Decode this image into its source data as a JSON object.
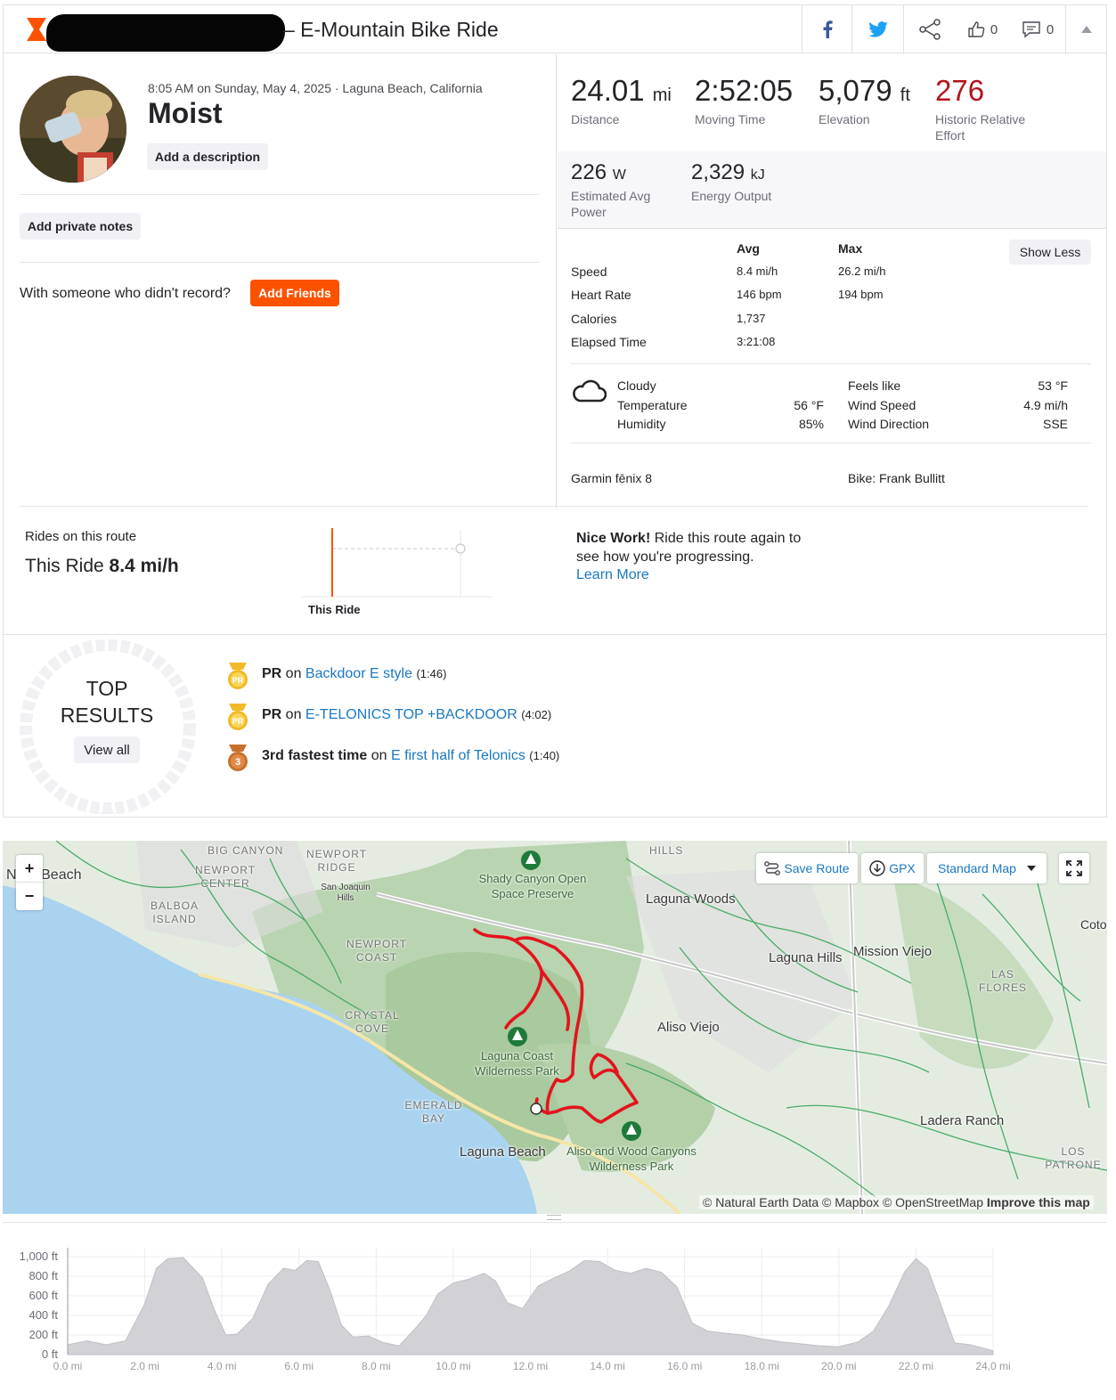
{
  "header": {
    "title": "– E-Mountain Bike Ride",
    "kudos_count": "0",
    "comments_count": "0"
  },
  "activity": {
    "datetime_location": "8:05 AM on Sunday, May 4, 2025 · Laguna Beach, California",
    "name": "Moist",
    "add_description": "Add a description",
    "add_private_notes": "Add private notes",
    "with_someone": "With someone who didn't record?",
    "add_friends": "Add Friends"
  },
  "primary_stats": [
    {
      "value": "24.01",
      "unit": "mi",
      "label": "Distance"
    },
    {
      "value": "2:52:05",
      "unit": "",
      "label": "Moving Time"
    },
    {
      "value": "5,079",
      "unit": "ft",
      "label": "Elevation"
    },
    {
      "value": "276",
      "unit": "",
      "label": "Historic Relative Effort"
    }
  ],
  "secondary_stats": [
    {
      "value": "226",
      "unit": "W",
      "label": "Estimated Avg Power"
    },
    {
      "value": "2,329",
      "unit": "kJ",
      "label": "Energy Output"
    }
  ],
  "detail_table": {
    "col_avg": "Avg",
    "col_max": "Max",
    "show_less": "Show Less",
    "rows": [
      {
        "label": "Speed",
        "avg": "8.4 mi/h",
        "max": "26.2 mi/h"
      },
      {
        "label": "Heart Rate",
        "avg": "146 bpm",
        "max": "194 bpm"
      },
      {
        "label": "Calories",
        "avg": "1,737",
        "max": ""
      },
      {
        "label": "Elapsed Time",
        "avg": "3:21:08",
        "max": ""
      }
    ]
  },
  "weather": {
    "condition": "Cloudy",
    "temperature_label": "Temperature",
    "temperature_value": "56 °F",
    "humidity_label": "Humidity",
    "humidity_value": "85%",
    "feels_like_label": "Feels like",
    "feels_like_value": "53 °F",
    "wind_speed_label": "Wind Speed",
    "wind_speed_value": "4.9 mi/h",
    "wind_direction_label": "Wind Direction",
    "wind_direction_value": "SSE"
  },
  "gear": {
    "device": "Garmin fēnix 8",
    "bike": "Bike: Frank Bullitt"
  },
  "route_compare": {
    "heading": "Rides on this route",
    "this_ride_label": "This Ride",
    "this_ride_value": "8.4 mi/h",
    "chart_caption": "This Ride",
    "nice_work_bold": "Nice Work!",
    "nice_work_text": " Ride this route again to see how you're progressing.",
    "learn_more": "Learn More"
  },
  "top_results": {
    "title_line1": "TOP",
    "title_line2": "RESULTS",
    "view_all": "View all",
    "items": [
      {
        "badge": "PR",
        "prefix": "PR",
        "on": " on ",
        "segment": "Backdoor E style",
        "time": "(1:46)"
      },
      {
        "badge": "PR",
        "prefix": "PR",
        "on": " on ",
        "segment": "E-TELONICS TOP +BACKDOOR",
        "time": "(4:02)"
      },
      {
        "badge": "3",
        "prefix": "3rd fastest time",
        "on": " on ",
        "segment": "E first half of Telonics",
        "time": "(1:40)"
      }
    ]
  },
  "map": {
    "save_route": "Save Route",
    "gpx": "GPX",
    "map_style": "Standard Map",
    "zoom_in": "+",
    "zoom_out": "−",
    "attribution": "© Natural Earth Data © Mapbox © OpenStreetMap",
    "improve": "Improve this map",
    "labels": {
      "newport_beach": "N     ort Beach",
      "big_canyon": "BIG CANYON",
      "newport_ridge": "NEWPORT RIDGE",
      "newport_center": "NEWPORT CENTER",
      "san_joaquin": "San Joaquin Hills",
      "balboa": "BALBOA ISLAND",
      "newport_coast": "NEWPORT COAST",
      "crystal_cove": "CRYSTAL COVE",
      "emerald_bay": "EMERALD BAY",
      "shady_canyon": "Shady Canyon Open Space Preserve",
      "laguna_woods": "Laguna Woods",
      "laguna_hills": "Laguna Hills",
      "mission_viejo": "Mission Viejo",
      "las_flores": "LAS FLORES",
      "aliso_viejo": "Aliso Viejo",
      "laguna_coast": "Laguna Coast Wilderness Park",
      "laguna_beach": "Laguna Beach",
      "aliso_wood": "Aliso and Wood Canyons Wilderness Park",
      "ladera_ranch": "Ladera Ranch",
      "los_patrones": "LOS PATRONE",
      "coto": "Coto",
      "hills": "HILLS"
    }
  },
  "chart_data": {
    "type": "area",
    "title": "",
    "xlabel": "",
    "ylabel": "",
    "x_unit": "mi",
    "y_unit": "ft",
    "xlim": [
      0,
      24
    ],
    "ylim": [
      0,
      1000
    ],
    "x_ticks": [
      "0.0 mi",
      "2.0 mi",
      "4.0 mi",
      "6.0 mi",
      "8.0 mi",
      "10.0 mi",
      "12.0 mi",
      "14.0 mi",
      "16.0 mi",
      "18.0 mi",
      "20.0 mi",
      "22.0 mi",
      "24.0 mi"
    ],
    "y_ticks": [
      "1,000 ft",
      "800 ft",
      "600 ft",
      "400 ft",
      "200 ft",
      "0 ft"
    ],
    "x": [
      0,
      0.5,
      1.0,
      1.5,
      2.0,
      2.3,
      2.6,
      3.0,
      3.5,
      3.8,
      4.1,
      4.4,
      4.8,
      5.2,
      5.6,
      5.9,
      6.2,
      6.5,
      6.8,
      7.1,
      7.4,
      7.8,
      8.2,
      8.6,
      9.0,
      9.3,
      9.6,
      10.0,
      10.4,
      10.8,
      11.1,
      11.4,
      11.8,
      12.2,
      12.6,
      13.0,
      13.4,
      13.8,
      14.2,
      14.6,
      15.0,
      15.4,
      15.8,
      16.2,
      16.6,
      17.0,
      17.5,
      18.0,
      18.5,
      19.0,
      19.5,
      20.0,
      20.5,
      20.9,
      21.3,
      21.7,
      22.0,
      22.3,
      22.6,
      23.0,
      23.4,
      23.8,
      24.0
    ],
    "y": [
      100,
      140,
      100,
      140,
      520,
      880,
      980,
      990,
      780,
      460,
      200,
      210,
      370,
      720,
      880,
      860,
      960,
      950,
      660,
      300,
      180,
      190,
      120,
      90,
      260,
      400,
      620,
      730,
      770,
      830,
      750,
      530,
      470,
      700,
      780,
      850,
      960,
      950,
      860,
      830,
      880,
      840,
      690,
      320,
      240,
      220,
      200,
      160,
      130,
      110,
      90,
      80,
      130,
      240,
      500,
      840,
      980,
      880,
      560,
      120,
      100,
      60,
      40
    ]
  }
}
